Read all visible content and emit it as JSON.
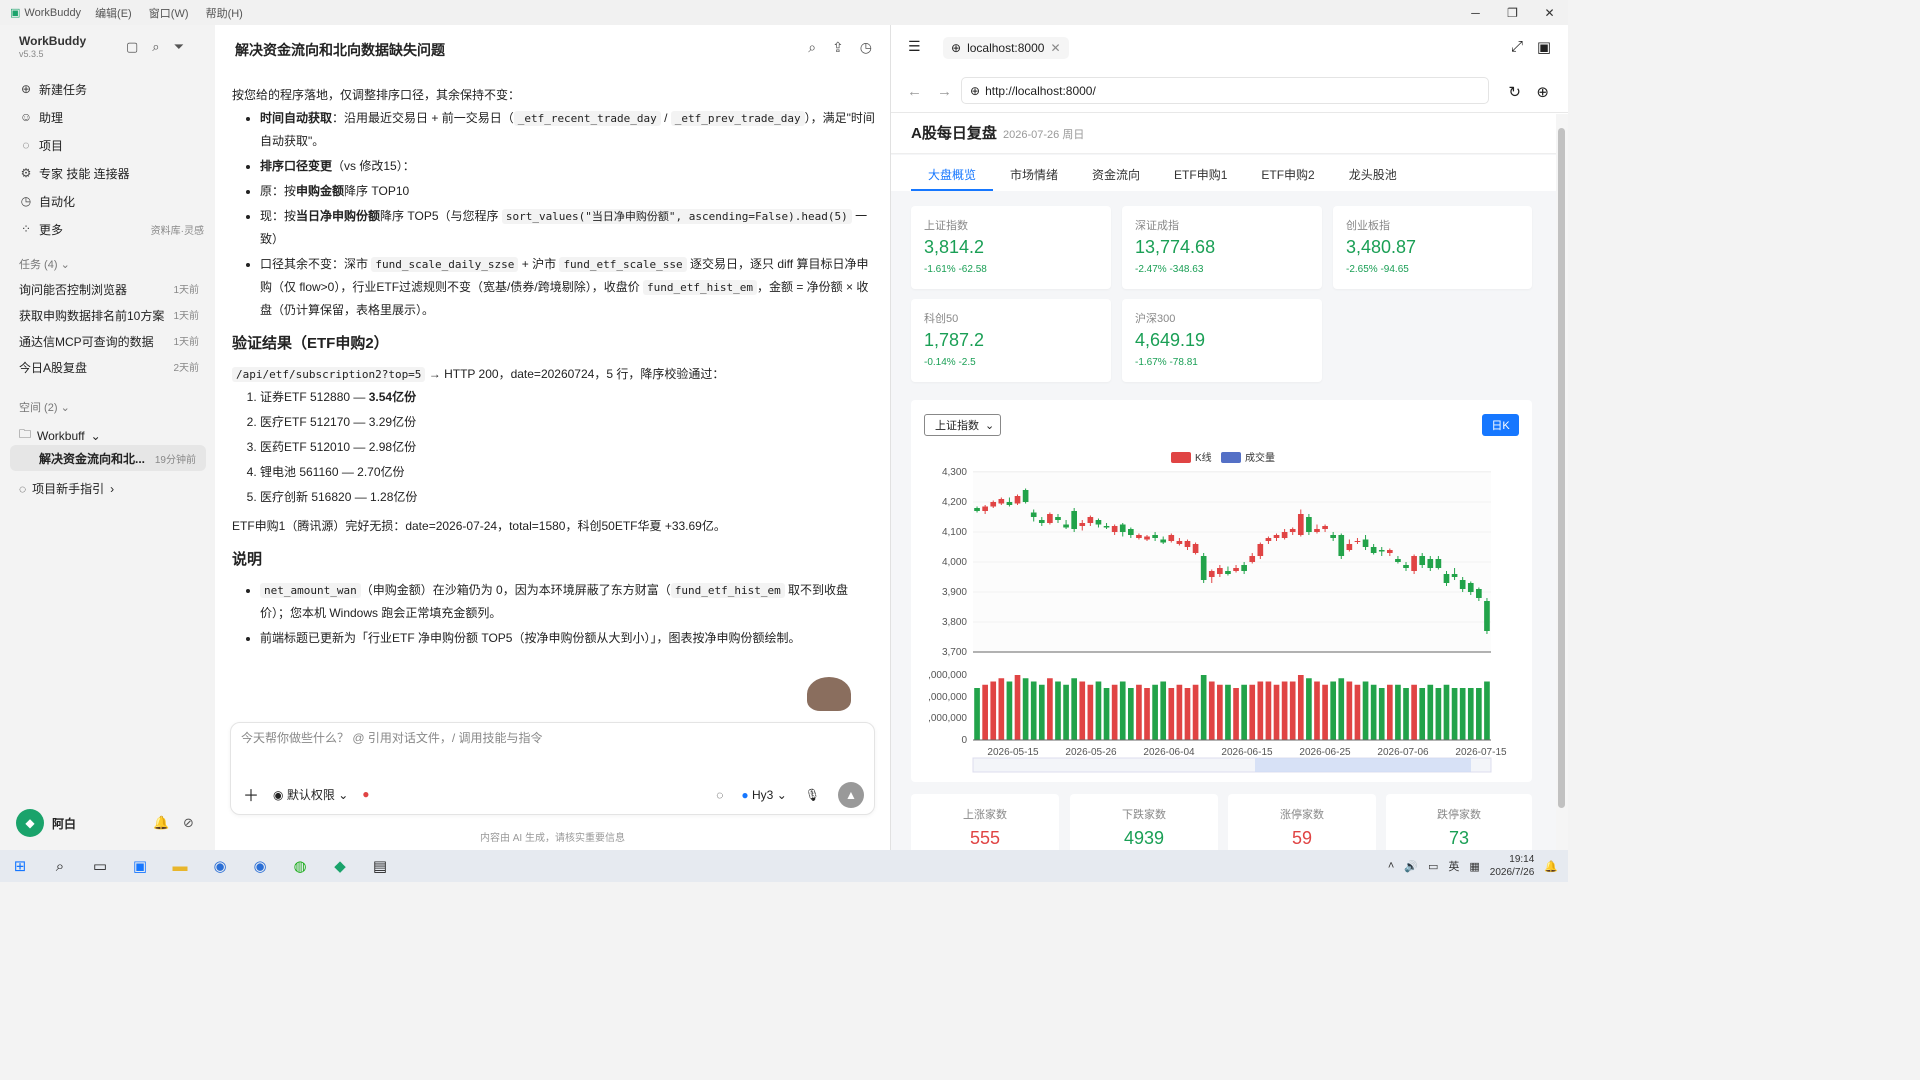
{
  "titlebar": {
    "app": "WorkBuddy",
    "menus": [
      "编辑(E)",
      "窗口(W)",
      "帮助(H)"
    ]
  },
  "sidebar": {
    "title": "WorkBuddy",
    "version": "v5.3.5",
    "nav": [
      {
        "label": "新建任务",
        "icon": "plus-circle-icon"
      },
      {
        "label": "助理",
        "icon": "assistant-icon"
      },
      {
        "label": "项目",
        "icon": "project-icon"
      },
      {
        "label": "专家 技能 连接器",
        "icon": "expert-icon"
      },
      {
        "label": "自动化",
        "icon": "automation-icon"
      },
      {
        "label": "更多",
        "icon": "more-icon",
        "right": "资料库·灵感"
      }
    ],
    "tasks_header": "任务 (4)",
    "tasks": [
      {
        "label": "询问能否控制浏览器",
        "time": "1天前"
      },
      {
        "label": "获取申购数据排名前10方案",
        "time": "1天前"
      },
      {
        "label": "通达信MCP可查询的数据",
        "time": "1天前"
      },
      {
        "label": "今日A股复盘",
        "time": "2天前"
      }
    ],
    "space_header": "空间 (2)",
    "workspace": "Workbuff",
    "selected_task": {
      "label": "解决资金流向和北...",
      "time": "19分钟前"
    },
    "guide": "项目新手指引",
    "user": "阿白"
  },
  "chat": {
    "title": "解决资金流向和北向数据缺失问题",
    "intro": "按您给的程序落地，仅调整排序口径，其余保持不变：",
    "b1_bold": "时间自动获取",
    "b1_a": "：沿用最近交易日 + 前一交易日（",
    "b1_c1": "_etf_recent_trade_day",
    "b1_sep": " / ",
    "b1_c2": "_etf_prev_trade_day",
    "b1_b": "），满足\"时间自动获取\"。",
    "b2_bold": "排序口径变更",
    "b2_rest": "（vs 修改15）：",
    "b3_a": "原：按",
    "b3_bold": "申购金额",
    "b3_b": "降序 TOP10",
    "b4_a": "现：按",
    "b4_bold": "当日净申购份额",
    "b4_b": "降序 TOP5（与您程序 ",
    "b4_code": "sort_values(\"当日净申购份额\", ascending=False).head(5)",
    "b4_c": " 一致）",
    "b5_a": "口径其余不变：深市 ",
    "b5_c1": "fund_scale_daily_szse",
    "b5_b": " + 沪市 ",
    "b5_c2": "fund_etf_scale_sse",
    "b5_c": " 逐交易日，逐只 diff 算目标日净申购（仅 flow>0），行业ETF过滤规则不变（宽基/债券/跨境剔除），收盘价 ",
    "b5_c3": "fund_etf_hist_em",
    "b5_d": "，金额 = 净份额 × 收盘（仍计算保留，表格里展示）。",
    "h_verify": "验证结果（ETF申购2）",
    "api_code": "/api/etf/subscription2?top=5",
    "api_rest": " → HTTP 200，date=20260724，5 行，降序校验通过：",
    "ranks": [
      {
        "name": "证券ETF 512880 — ",
        "val": "3.54亿份"
      },
      {
        "name": "医疗ETF 512170 — ",
        "val": "3.29亿份"
      },
      {
        "name": "医药ETF 512010 — ",
        "val": "2.98亿份"
      },
      {
        "name": "锂电池 561160 — ",
        "val": "2.70亿份"
      },
      {
        "name": "医疗创新 516820 — ",
        "val": "1.28亿份"
      }
    ],
    "etf1": "ETF申购1（腾讯源）完好无损：date=2026-07-24，total=1580，科创50ETF华夏 +33.69亿。",
    "h_note": "说明",
    "n1_code": "net_amount_wan",
    "n1_a": "（申购金额）在沙箱仍为 0，因为本环境屏蔽了东方财富（",
    "n1_code2": "fund_etf_hist_em",
    "n1_b": " 取不到收盘价）；您本机 Windows 跑会正常填充金额列。",
    "n2": "前端标题已更新为「行业ETF 净申购份额 TOP5（按净申购份额从大到小）」，图表按净申购份额绘制。",
    "input_placeholder": "今天帮你做些什么？ @ 引用对话文件，/ 调用技能与指令",
    "perm": "默认权限",
    "model": "Hy3",
    "disclaimer": "内容由 AI 生成，请核实重要信息"
  },
  "browser": {
    "tab": "localhost:8000",
    "url": "http://localhost:8000/",
    "title": "A股每日复盘",
    "date": "2026-07-26 周日",
    "tabs": [
      "大盘概览",
      "市场情绪",
      "资金流向",
      "ETF申购1",
      "ETF申购2",
      "龙头股池"
    ],
    "indices": [
      {
        "name": "上证指数",
        "value": "3,814.2",
        "change": "-1.61% -62.58"
      },
      {
        "name": "深证成指",
        "value": "13,774.68",
        "change": "-2.47% -348.63"
      },
      {
        "name": "创业板指",
        "value": "3,480.87",
        "change": "-2.65% -94.65"
      },
      {
        "name": "科创50",
        "value": "1,787.2",
        "change": "-0.14% -2.5"
      },
      {
        "name": "沪深300",
        "value": "4,649.19",
        "change": "-1.67% -78.81"
      }
    ],
    "select": "上证指数",
    "btn": "日K",
    "stats": [
      {
        "name": "上涨家数",
        "value": "555"
      },
      {
        "name": "下跌家数",
        "value": "4939"
      },
      {
        "name": "涨停家数",
        "value": "59"
      },
      {
        "name": "跌停家数",
        "value": "73"
      }
    ]
  },
  "chart_data": {
    "type": "candlestick",
    "legend": [
      "K线",
      "成交量"
    ],
    "colors": {
      "up": "#e04444",
      "down": "#22a34a",
      "vol_legend": "#5470c6"
    },
    "y_ticks": [
      "4,300",
      "4,200",
      "4,100",
      "4,000",
      "3,900",
      "3,800",
      "3,700"
    ],
    "ylim": [
      3700,
      4300
    ],
    "vol_ticks": [
      ",000,000",
      ",000,000",
      ",000,000",
      "0"
    ],
    "x_labels": [
      "2026-05-15",
      "2026-05-26",
      "2026-06-04",
      "2026-06-15",
      "2026-06-25",
      "2026-07-06",
      "2026-07-15"
    ],
    "candles": [
      [
        4180,
        4170,
        4185,
        4165
      ],
      [
        4170,
        4185,
        4190,
        4160
      ],
      [
        4185,
        4200,
        4205,
        4180
      ],
      [
        4195,
        4210,
        4215,
        4190
      ],
      [
        4200,
        4190,
        4215,
        4185
      ],
      [
        4195,
        4220,
        4225,
        4190
      ],
      [
        4240,
        4200,
        4245,
        4195
      ],
      [
        4165,
        4150,
        4175,
        4135
      ],
      [
        4140,
        4130,
        4150,
        4120
      ],
      [
        4130,
        4160,
        4165,
        4125
      ],
      [
        4150,
        4140,
        4160,
        4130
      ],
      [
        4125,
        4115,
        4140,
        4110
      ],
      [
        4170,
        4110,
        4180,
        4100
      ],
      [
        4120,
        4130,
        4140,
        4105
      ],
      [
        4130,
        4150,
        4155,
        4120
      ],
      [
        4140,
        4125,
        4145,
        4115
      ],
      [
        4120,
        4115,
        4130,
        4110
      ],
      [
        4100,
        4120,
        4125,
        4090
      ],
      [
        4125,
        4100,
        4130,
        4085
      ],
      [
        4110,
        4090,
        4115,
        4080
      ],
      [
        4080,
        4090,
        4095,
        4075
      ],
      [
        4075,
        4085,
        4090,
        4070
      ],
      [
        4090,
        4080,
        4100,
        4070
      ],
      [
        4075,
        4065,
        4085,
        4060
      ],
      [
        4070,
        4090,
        4095,
        4065
      ],
      [
        4060,
        4070,
        4080,
        4055
      ],
      [
        4050,
        4070,
        4075,
        4040
      ],
      [
        4030,
        4060,
        4065,
        4025
      ],
      [
        4020,
        3940,
        4030,
        3930
      ],
      [
        3950,
        3970,
        3975,
        3930
      ],
      [
        3960,
        3980,
        3990,
        3950
      ],
      [
        3970,
        3960,
        3985,
        3955
      ],
      [
        3970,
        3980,
        3990,
        3965
      ],
      [
        3990,
        3970,
        4000,
        3960
      ],
      [
        4000,
        4020,
        4030,
        3995
      ],
      [
        4020,
        4060,
        4065,
        4010
      ],
      [
        4070,
        4080,
        4085,
        4060
      ],
      [
        4080,
        4090,
        4095,
        4070
      ],
      [
        4080,
        4100,
        4110,
        4075
      ],
      [
        4100,
        4110,
        4115,
        4090
      ],
      [
        4090,
        4160,
        4175,
        4085
      ],
      [
        4150,
        4100,
        4160,
        4090
      ],
      [
        4100,
        4110,
        4125,
        4095
      ],
      [
        4110,
        4120,
        4125,
        4100
      ],
      [
        4090,
        4080,
        4100,
        4070
      ],
      [
        4090,
        4020,
        4095,
        4010
      ],
      [
        4040,
        4060,
        4075,
        4035
      ],
      [
        4070,
        4070,
        4080,
        4060
      ],
      [
        4075,
        4050,
        4090,
        4040
      ],
      [
        4050,
        4030,
        4060,
        4025
      ],
      [
        4040,
        4035,
        4050,
        4020
      ],
      [
        4030,
        4040,
        4045,
        4020
      ],
      [
        4010,
        4000,
        4020,
        3995
      ],
      [
        3990,
        3980,
        4000,
        3970
      ],
      [
        3970,
        4020,
        4025,
        3960
      ],
      [
        4020,
        3990,
        4030,
        3980
      ],
      [
        4010,
        3980,
        4020,
        3970
      ],
      [
        4010,
        3980,
        4020,
        3975
      ],
      [
        3960,
        3930,
        3970,
        3920
      ],
      [
        3960,
        3950,
        3980,
        3940
      ],
      [
        3940,
        3910,
        3950,
        3900
      ],
      [
        3930,
        3900,
        3935,
        3890
      ],
      [
        3910,
        3880,
        3915,
        3870
      ],
      [
        3870,
        3770,
        3880,
        3760
      ]
    ],
    "volume": [
      0.8,
      0.85,
      0.9,
      0.95,
      0.9,
      1.0,
      0.95,
      0.9,
      0.85,
      0.95,
      0.9,
      0.85,
      0.95,
      0.9,
      0.85,
      0.9,
      0.8,
      0.85,
      0.9,
      0.8,
      0.85,
      0.8,
      0.85,
      0.9,
      0.8,
      0.85,
      0.8,
      0.85,
      1.0,
      0.9,
      0.85,
      0.85,
      0.8,
      0.85,
      0.85,
      0.9,
      0.9,
      0.85,
      0.9,
      0.9,
      1.0,
      0.95,
      0.9,
      0.85,
      0.9,
      0.95,
      0.9,
      0.85,
      0.9,
      0.85,
      0.8,
      0.85,
      0.85,
      0.8,
      0.85,
      0.8,
      0.85,
      0.8,
      0.85,
      0.8,
      0.8,
      0.8,
      0.8,
      0.9
    ]
  }
}
